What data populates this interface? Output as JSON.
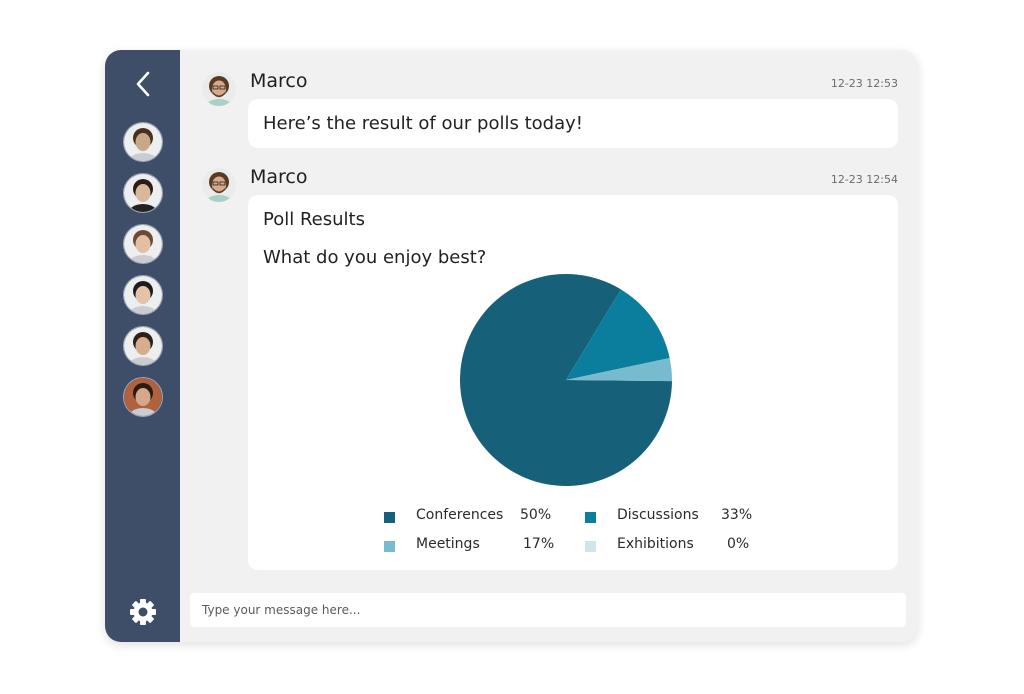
{
  "sidebar": {
    "back_icon": "chevron-left-icon",
    "contacts": [
      {
        "name": "contact-1",
        "avatar_color": "#c7a98a",
        "hair": "#4a2f1f"
      },
      {
        "name": "contact-2",
        "avatar_color": "#d9b79a",
        "hair": "#2b1d16"
      },
      {
        "name": "contact-3",
        "avatar_color": "#e1bfa1",
        "hair": "#6b4a30"
      },
      {
        "name": "contact-4",
        "avatar_color": "#e4c3a8",
        "hair": "#1c1a1a"
      },
      {
        "name": "contact-5",
        "avatar_color": "#d6ad8e",
        "hair": "#2e1f18"
      },
      {
        "name": "contact-6",
        "avatar_color": "#d5a88a",
        "hair": "#2a1b14"
      }
    ],
    "settings_icon": "gear-icon"
  },
  "messages": [
    {
      "sender": "Marco",
      "time": "12-23 12:53",
      "text": "Here’s the result of our polls today!"
    },
    {
      "sender": "Marco",
      "time": "12-23 12:54",
      "poll": {
        "title": "Poll Results",
        "question": "What do you enjoy best?"
      }
    }
  ],
  "chart_data": {
    "type": "pie",
    "title": "What do you enjoy best?",
    "categories": [
      "Conferences",
      "Discussions",
      "Meetings",
      "Exhibitions"
    ],
    "values": [
      50,
      33,
      17,
      0
    ],
    "value_labels": [
      "50%",
      "33%",
      "17%",
      "0%"
    ],
    "colors": [
      "#166079",
      "#0b7e9e",
      "#78bbcf",
      "#cfe5ec"
    ],
    "legend": "bottom",
    "drawn_fractions": [
      0.835,
      0.13,
      0.035,
      0
    ]
  },
  "input": {
    "placeholder": "Type your message here..."
  }
}
